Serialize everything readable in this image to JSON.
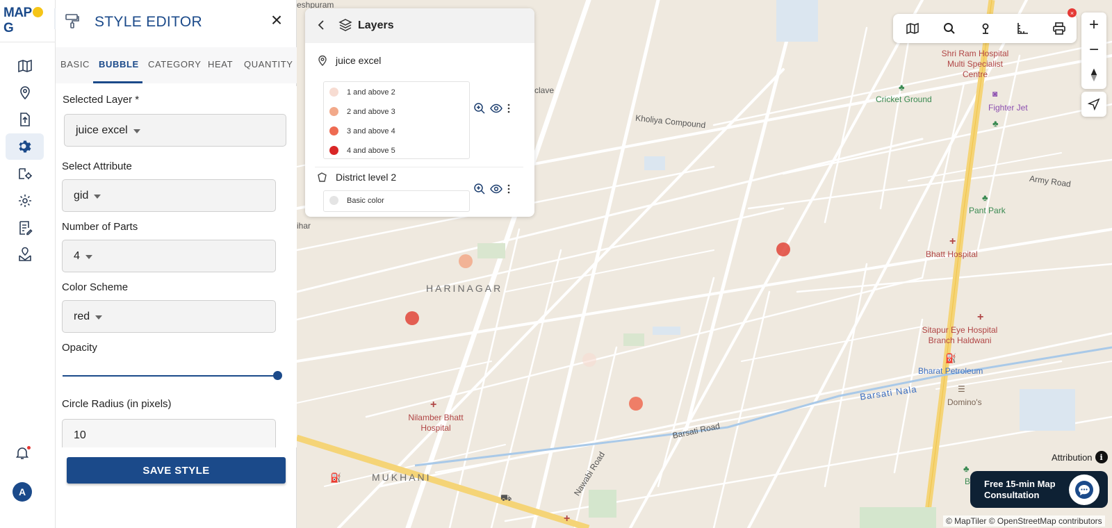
{
  "app": {
    "logo_text": "MAPOG"
  },
  "panel": {
    "title": "STYLE EDITOR",
    "close_glyph": "×",
    "tabs": [
      {
        "label": "BASIC"
      },
      {
        "label": "BUBBLE",
        "active": true
      },
      {
        "label": "CATEGORY"
      },
      {
        "label": "HEAT"
      },
      {
        "label": "QUANTITY"
      }
    ],
    "fields": {
      "selected_layer": {
        "label": "Selected Layer *",
        "value": "juice excel"
      },
      "attribute": {
        "label": "Select Attribute",
        "value": "gid"
      },
      "parts": {
        "label": "Number of Parts",
        "value": "4"
      },
      "scheme": {
        "label": "Color Scheme",
        "value": "red"
      },
      "opacity": {
        "label": "Opacity",
        "value": 1.0
      },
      "radius": {
        "label": "Circle Radius (in pixels)",
        "value": "10"
      }
    },
    "save_label": "SAVE STYLE"
  },
  "layers": {
    "title": "Layers",
    "items": [
      {
        "name": "juice excel",
        "legend": [
          {
            "label": "1 and above 2",
            "color": "#f7dcd2"
          },
          {
            "label": "2 and above 3",
            "color": "#f2a98a"
          },
          {
            "label": "3 and above 4",
            "color": "#ee6b52"
          },
          {
            "label": "4 and above 5",
            "color": "#d92626"
          }
        ]
      },
      {
        "name": "District level 2",
        "legend": [
          {
            "label": "Basic color",
            "color": "#e4e4e4"
          }
        ]
      }
    ]
  },
  "map": {
    "labels": {
      "harinagar": "HARINAGAR",
      "mukhani": "MUKHANI",
      "kholiya": "Kholiya Compound",
      "clave": "clave",
      "vihar": "ihar",
      "barsati_road": "Barsati Road",
      "barsati_nala": "Barsati Nala",
      "nawabi": "Nawabi Road",
      "army": "Army Road",
      "shri_ram": "Shri Ram Hospital Multi Specialist Centre",
      "cricket": "Cricket Ground",
      "fighter": "Fighter Jet",
      "pant": "Pant Park",
      "bhatt": "Bhatt Hospital",
      "sitapur": "Sitapur Eye Hospital Branch Haldwani",
      "bharat": "Bharat Petroleum",
      "dominos": "Domino's",
      "nilamber": "Nilamber Bhatt Hospital",
      "barren": "Barren",
      "top": "eshpuram"
    },
    "attribution": "Attribution",
    "copyright": "© MapTiler © OpenStreetMap contributors",
    "consult": "Free 15-min Map Consultation"
  },
  "colors": {
    "brand": "#1b4a8a",
    "bubble_light": "#f7dcd2",
    "bubble_mid": "#f2a98a",
    "bubble_strong": "#ee6b52",
    "bubble_dark": "#d92626"
  }
}
